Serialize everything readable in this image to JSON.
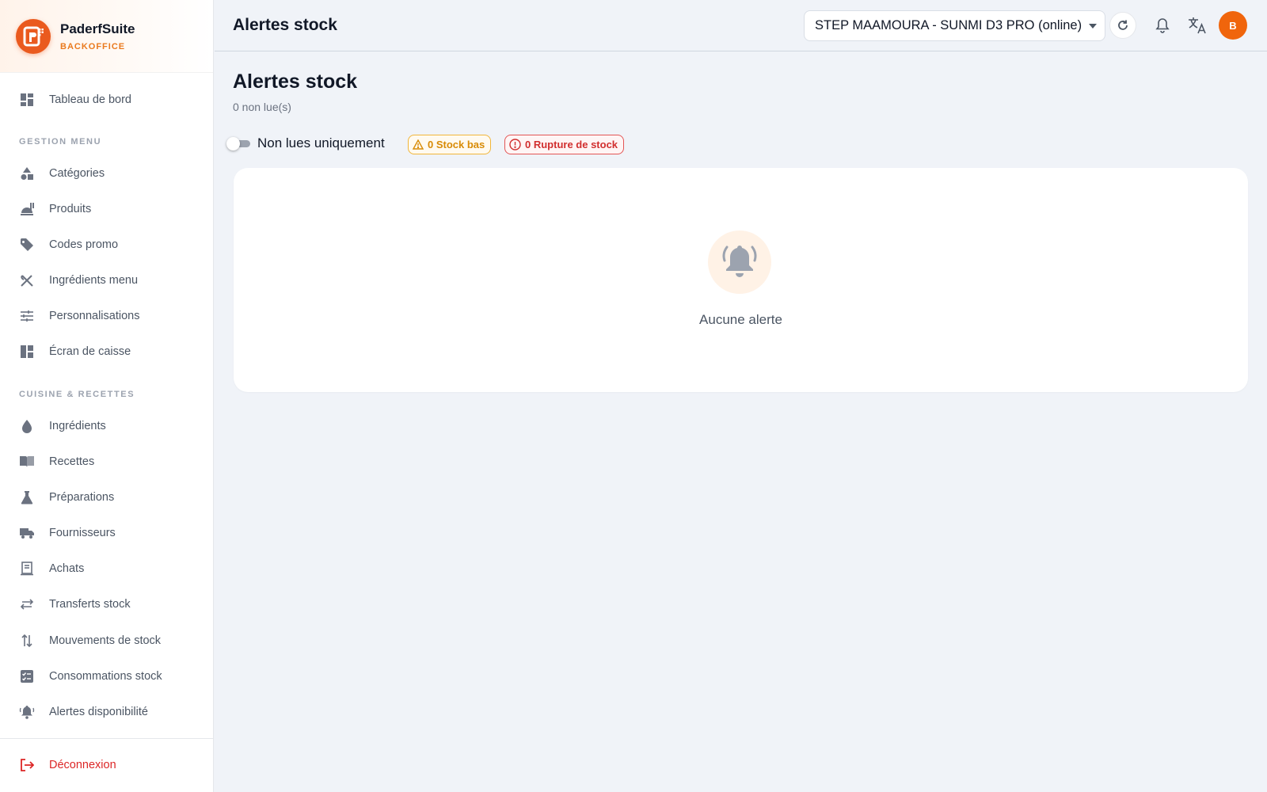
{
  "brand": {
    "name": "PaderfSuite",
    "subtitle": "BACKOFFICE"
  },
  "sidebar": {
    "dashboard": {
      "label": "Tableau de bord",
      "icon": "dashboard-icon"
    },
    "section_menu": "GESTION MENU",
    "menu_items": [
      {
        "label": "Catégories",
        "icon": "categories-icon"
      },
      {
        "label": "Produits",
        "icon": "products-icon"
      },
      {
        "label": "Codes promo",
        "icon": "tag-icon"
      },
      {
        "label": "Ingrédients menu",
        "icon": "utensils-icon"
      },
      {
        "label": "Personnalisations",
        "icon": "sliders-icon"
      },
      {
        "label": "Écran de caisse",
        "icon": "layout-icon"
      }
    ],
    "section_kitchen": "CUISINE & RECETTES",
    "kitchen_items": [
      {
        "label": "Ingrédients",
        "icon": "drop-icon"
      },
      {
        "label": "Recettes",
        "icon": "book-icon"
      },
      {
        "label": "Préparations",
        "icon": "flask-icon"
      },
      {
        "label": "Fournisseurs",
        "icon": "truck-icon"
      },
      {
        "label": "Achats",
        "icon": "receipt-icon"
      },
      {
        "label": "Transferts stock",
        "icon": "transfer-icon"
      },
      {
        "label": "Mouvements de stock",
        "icon": "updown-icon"
      },
      {
        "label": "Consommations stock",
        "icon": "checklist-icon"
      },
      {
        "label": "Alertes disponibilité",
        "icon": "bell-ring-icon"
      }
    ],
    "logout": {
      "label": "Déconnexion",
      "icon": "logout-icon"
    }
  },
  "topbar": {
    "title": "Alertes stock",
    "store_select": "STEP MAAMOURA - SUNMI D3 PRO (online)",
    "avatar_initial": "B"
  },
  "main": {
    "title": "Alertes stock",
    "unread": "0 non lue(s)",
    "toggle_label": "Non lues uniquement",
    "toggle_on": false,
    "chip_low": "0 Stock bas",
    "chip_out": "0 Rupture de stock",
    "empty_text": "Aucune alerte"
  },
  "colors": {
    "accent": "#ea5a1e",
    "warning": "#d88b06",
    "danger": "#d12f2f"
  }
}
